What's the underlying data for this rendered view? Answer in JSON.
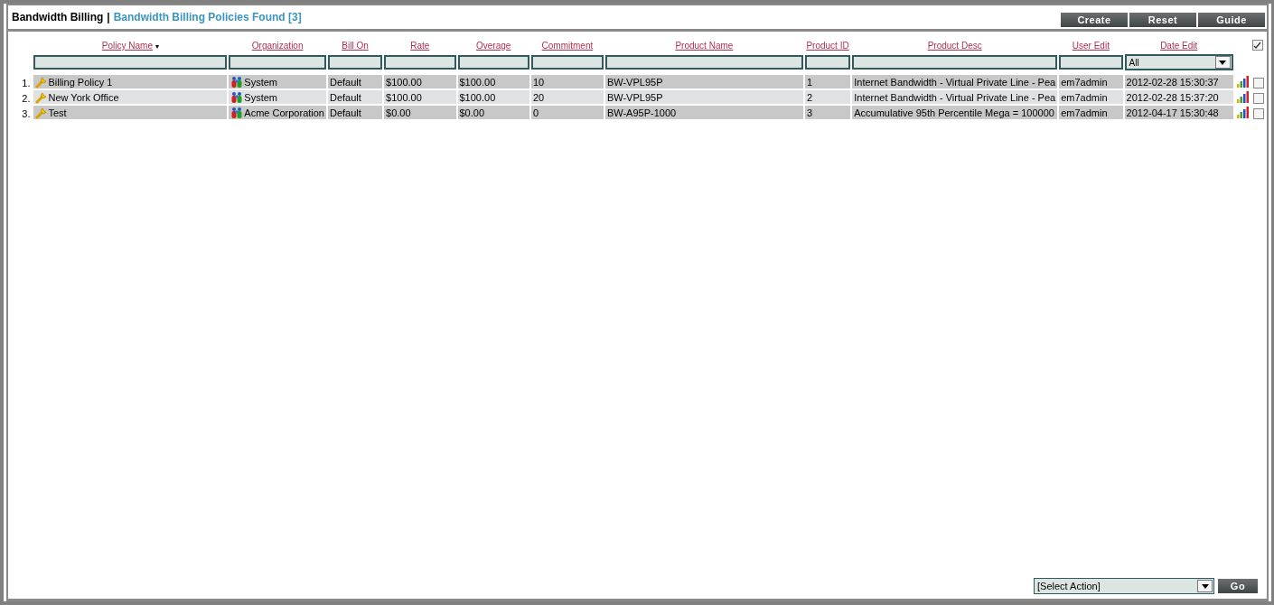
{
  "header": {
    "title": "Bandwidth Billing",
    "separator": "|",
    "subtitle": "Bandwidth Billing Policies Found [3]"
  },
  "buttons": [
    "Create",
    "Reset",
    "Guide"
  ],
  "table": {
    "columns": [
      {
        "label": "Policy Name",
        "sort_mark": "▾",
        "kind": "text"
      },
      {
        "label": "Organization",
        "kind": "text"
      },
      {
        "label": "Bill On",
        "kind": "text"
      },
      {
        "label": "Rate",
        "kind": "text"
      },
      {
        "label": "Overage",
        "kind": "text"
      },
      {
        "label": "Commitment",
        "kind": "text"
      },
      {
        "label": "Product Name",
        "kind": "text"
      },
      {
        "label": "Product ID",
        "kind": "text"
      },
      {
        "label": "Product Desc",
        "kind": "text"
      },
      {
        "label": "User Edit",
        "kind": "text"
      },
      {
        "label": "Date Edit",
        "kind": "select",
        "filter_value": "All"
      }
    ],
    "select_all": {
      "checked": true
    },
    "rows": [
      {
        "number": "1.",
        "cells": [
          "Billing Policy 1",
          "System",
          "Default",
          "$100.00",
          "$100.00",
          "10",
          "BW-VPL95P",
          "1",
          "Internet Bandwidth - Virtual Private Line - Pea",
          "em7admin",
          "2012-02-28 15:30:37"
        ],
        "selected": false
      },
      {
        "number": "2.",
        "cells": [
          "New York Office",
          "System",
          "Default",
          "$100.00",
          "$100.00",
          "20",
          "BW-VPL95P",
          "2",
          "Internet Bandwidth - Virtual Private Line - Pea",
          "em7admin",
          "2012-02-28 15:37:20"
        ],
        "selected": false
      },
      {
        "number": "3.",
        "cells": [
          "Test",
          "Acme Corporation",
          "Default",
          "$0.00",
          "$0.00",
          "0",
          "BW-A95P-1000",
          "3",
          "Accumulative 95th Percentile Mega = 100000",
          "em7admin",
          "2012-04-17 15:30:48"
        ],
        "selected": false
      }
    ]
  },
  "footer": {
    "action_select": "[Select Action]",
    "go_button": "Go"
  }
}
